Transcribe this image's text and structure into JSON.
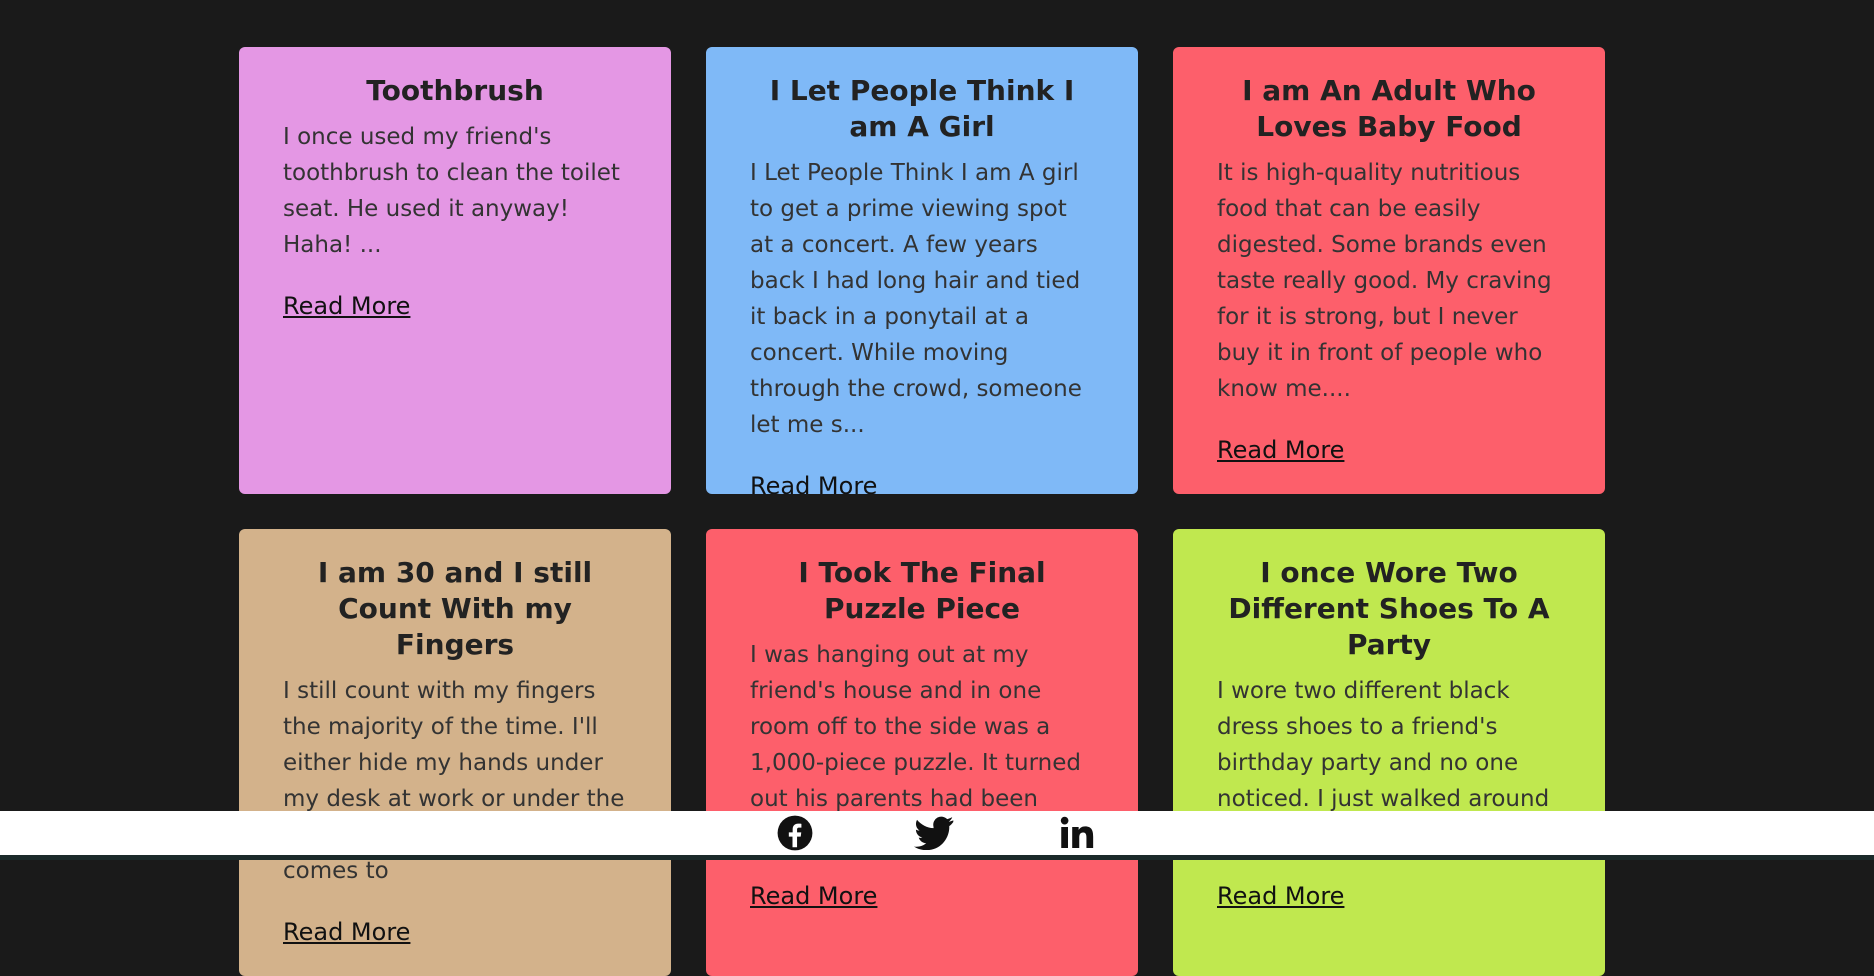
{
  "cards": [
    {
      "title": "Toothbrush",
      "text": "I once used my friend's toothbrush to clean the toilet seat. He used it anyway! Haha! ...",
      "link": "Read More",
      "color": "#e497e4"
    },
    {
      "title": "I Let People Think I am A Girl",
      "text": "I Let People Think I am A girl to get a prime viewing spot at a concert. A few years back I had long hair and tied it back in a ponytail at a concert. While moving through the crowd, someone let me s...",
      "link": "Read More",
      "color": "#7fb9f7"
    },
    {
      "title": "I am An Adult Who Loves Baby Food",
      "text": "It is high-quality nutritious food that can be easily digested. Some brands even taste really good. My craving for it is strong, but I never buy it in front of people who know me....",
      "link": "Read More",
      "color": "#fd5f6b"
    },
    {
      "title": "I am 30 and I still Count With my Fingers",
      "text": "I still count with my fingers the majority of the time. I'll either hide my hands under my desk at work or under the table at a restaurant. If push comes to",
      "link": "Read More",
      "color": "#d3b28b"
    },
    {
      "title": "I Took The Final Puzzle Piece",
      "text": "I was hanging out at my friend's house and in one room off to the side was a 1,000-piece puzzle. It turned out his parents had been working on it for a",
      "link": "Read More",
      "color": "#fd5f6b"
    },
    {
      "title": "I once Wore Two Different Shoes To A Party",
      "text": "I wore two different black dress shoes to a friend's birthday party and no one noticed. I just walked around confident and",
      "link": "Read More",
      "color": "#c0e84f"
    }
  ],
  "footer": {
    "icons": [
      "facebook-icon",
      "twitter-icon",
      "linkedin-icon"
    ]
  },
  "colors": {
    "background": "#1a1a1a",
    "footer": "#ffffff"
  }
}
